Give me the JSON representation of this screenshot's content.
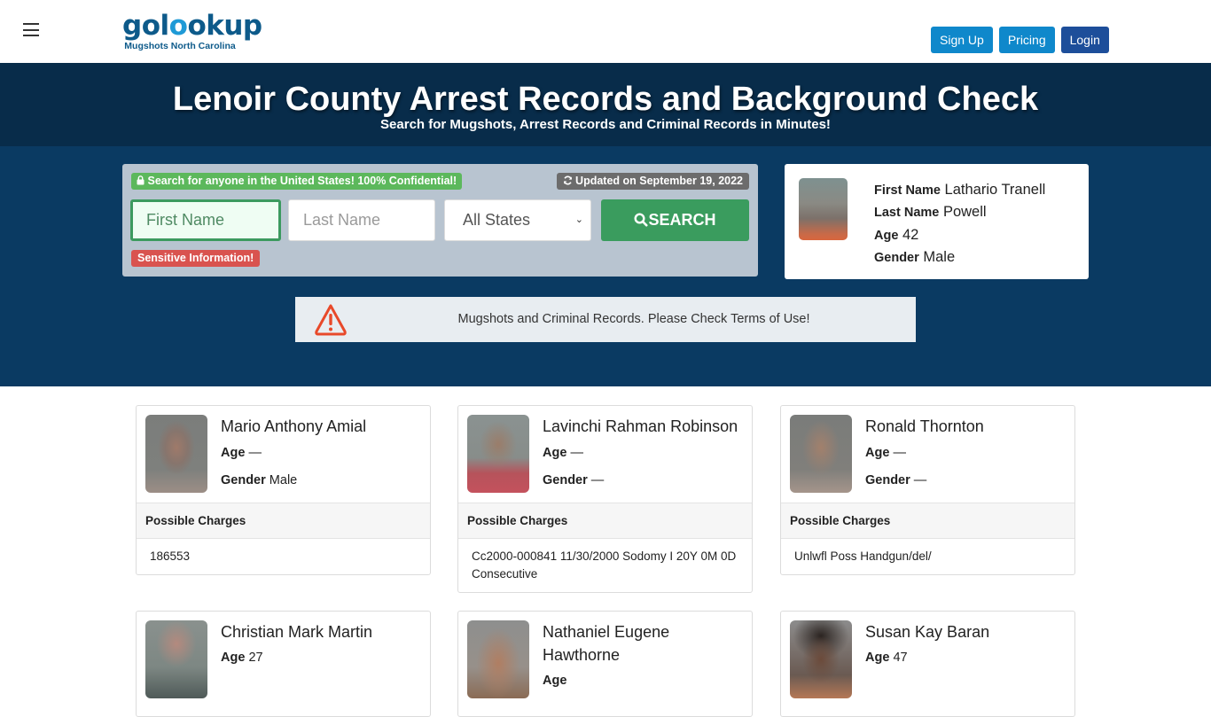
{
  "header": {
    "menu_icon": "hamburger-menu-icon",
    "logo_text_part1": "gol",
    "logo_text_o": "o",
    "logo_text_part2": "okup",
    "logo_subtitle": "Mugshots North Carolina",
    "nav": {
      "signup": "Sign Up",
      "pricing": "Pricing",
      "login": "Login"
    },
    "colors": {
      "primary_button": "#0f88cb",
      "login_button": "#1d4e9a"
    }
  },
  "hero": {
    "title": "Lenoir County Arrest Records and Background Check",
    "subtitle": "Search for Mugshots, Arrest Records and Criminal Records in Minutes!"
  },
  "search": {
    "confidential_badge": "Search for anyone in the United States! 100% Confidential!",
    "updated_badge": "Updated on September 19, 2022",
    "first_name_placeholder": "First Name",
    "last_name_placeholder": "Last Name",
    "state_selected": "All States",
    "search_button": "SEARCH",
    "sensitive_badge": "Sensitive Information!"
  },
  "featured": {
    "first_name_label": "First Name",
    "first_name": "Lathario Tranell",
    "last_name_label": "Last Name",
    "last_name": "Powell",
    "age_label": "Age",
    "age": "42",
    "gender_label": "Gender",
    "gender": "Male"
  },
  "warning": {
    "icon": "warning-triangle-icon",
    "text": "Mugshots and Criminal Records. Please Check Terms of Use!"
  },
  "records": [
    {
      "name": "Mario Anthony Amial",
      "age_label": "Age",
      "age": "—",
      "gender_label": "Gender",
      "gender": "Male",
      "charges_label": "Possible Charges",
      "charges": "186553"
    },
    {
      "name": "Lavinchi Rahman Robinson",
      "age_label": "Age",
      "age": "—",
      "gender_label": "Gender",
      "gender": "—",
      "charges_label": "Possible Charges",
      "charges": "Cc2000-000841 11/30/2000 Sodomy I 20Y 0M 0D Consecutive"
    },
    {
      "name": "Ronald Thornton",
      "age_label": "Age",
      "age": "—",
      "gender_label": "Gender",
      "gender": "—",
      "charges_label": "Possible Charges",
      "charges": "Unlwfl Poss Handgun/del/"
    },
    {
      "name": "Christian Mark Martin",
      "age_label": "Age",
      "age": "27"
    },
    {
      "name": "Nathaniel Eugene Hawthorne",
      "age_label": "Age",
      "age": ""
    },
    {
      "name": "Susan Kay Baran",
      "age_label": "Age",
      "age": "47"
    }
  ]
}
